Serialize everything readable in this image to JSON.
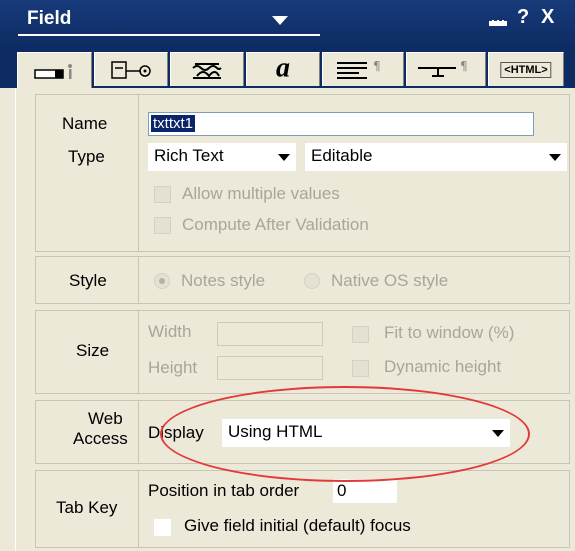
{
  "window": {
    "title": "Field",
    "icons": {
      "minimize": "minimize-icon",
      "help": "?",
      "close": "X"
    }
  },
  "tabs": [
    {
      "name": "field-info",
      "icon": "field-info-icon"
    },
    {
      "name": "control",
      "icon": "control-icon"
    },
    {
      "name": "advanced",
      "icon": "advanced-icon"
    },
    {
      "name": "font",
      "icon": "font-icon"
    },
    {
      "name": "paragraph",
      "icon": "paragraph-icon"
    },
    {
      "name": "hide-when",
      "icon": "hide-when-icon"
    },
    {
      "name": "html",
      "label": "<HTML>"
    }
  ],
  "basics": {
    "name_label": "Name",
    "name_value": "txttxt1",
    "type_label": "Type",
    "type_value": "Rich Text",
    "mode_value": "Editable",
    "allow_multiple": "Allow multiple values",
    "compute_after": "Compute After Validation"
  },
  "style": {
    "label": "Style",
    "option1": "Notes style",
    "option2": "Native OS style"
  },
  "size": {
    "label": "Size",
    "width_label": "Width",
    "height_label": "Height",
    "fit_label": "Fit to window (%)",
    "dynamic_label": "Dynamic height"
  },
  "web": {
    "label_line1": "Web",
    "label_line2": "Access",
    "display_label": "Display",
    "display_value": "Using HTML"
  },
  "tabkey": {
    "label": "Tab Key",
    "position_label": "Position in tab order",
    "position_value": "0",
    "focus_label": "Give field initial (default) focus"
  },
  "colors": {
    "titlebar": "#173a7a",
    "panel": "#ece9d8",
    "annotation": "#e23a3a"
  }
}
